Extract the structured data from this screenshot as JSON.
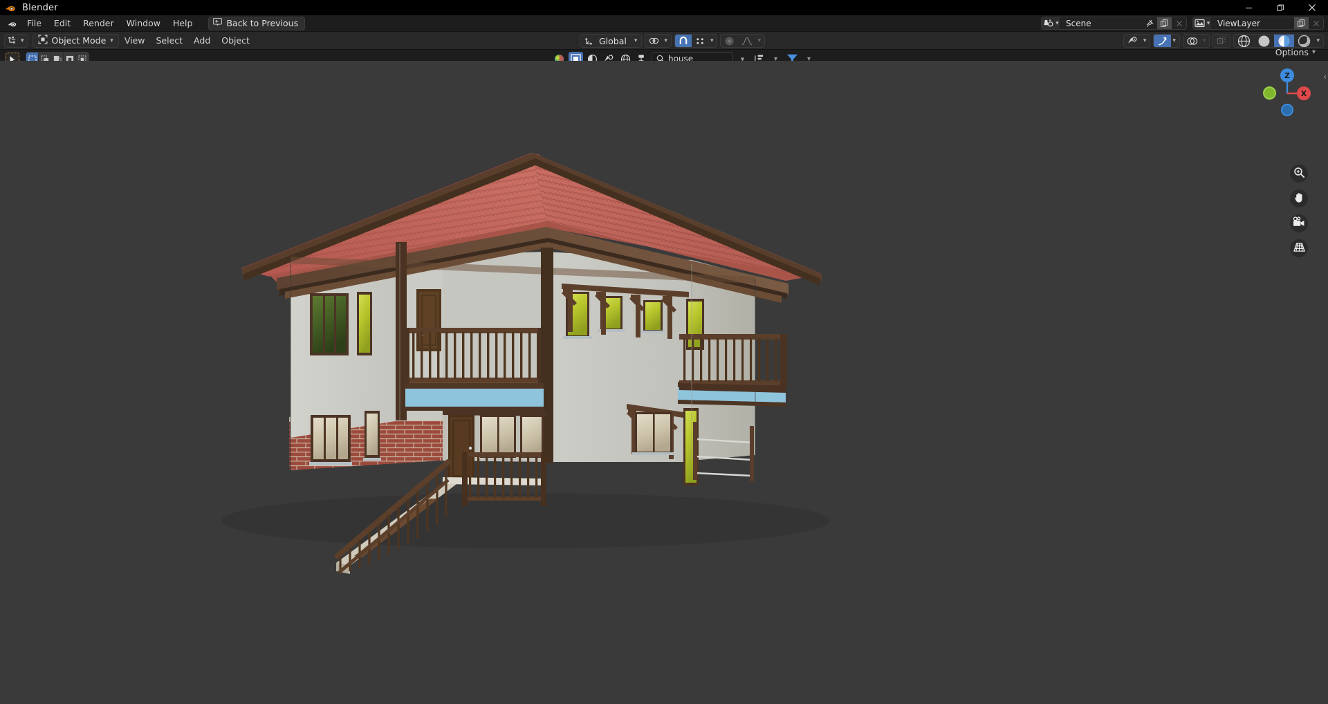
{
  "window": {
    "title": "Blender",
    "controls": {
      "minimize": "—",
      "restore": "❐",
      "close": "✕"
    }
  },
  "menubar": {
    "logo_icon": "blender-logo-icon",
    "items": [
      {
        "label": "File"
      },
      {
        "label": "Edit"
      },
      {
        "label": "Render"
      },
      {
        "label": "Window"
      },
      {
        "label": "Help"
      }
    ],
    "back_to_previous": {
      "label": "Back to Previous",
      "icon": "back-to-previous-icon"
    },
    "scene": {
      "icon": "scene-data-icon",
      "name": "Scene",
      "pin_icon": "pin-icon",
      "new_icon": "new-scene-icon",
      "unlink_icon": "unlink-icon"
    },
    "viewlayer": {
      "icon": "view-layer-icon",
      "name": "ViewLayer",
      "new_icon": "new-viewlayer-icon",
      "unlink_icon": "unlink-icon"
    }
  },
  "viewport_header": {
    "editor_type_icon": "editor-type-3dview-icon",
    "mode": {
      "icon": "object-mode-icon",
      "label": "Object Mode",
      "chevron": "⌄"
    },
    "menus": [
      {
        "label": "View"
      },
      {
        "label": "Select"
      },
      {
        "label": "Add"
      },
      {
        "label": "Object"
      }
    ],
    "transform_orientation": {
      "icon": "transform-orientation-icon",
      "label": "Global",
      "chevron": "⌄"
    },
    "pivot_point": {
      "icon": "pivot-point-icon",
      "chevron": "⌄"
    },
    "snap": {
      "icon": "snap-magnet-icon",
      "active": true
    },
    "snap_target": {
      "icon": "snap-target-icon",
      "chevron": "⌄"
    },
    "proportional_edit": {
      "icon": "proportional-edit-icon",
      "active": false
    },
    "falloff": {
      "icon": "proportional-falloff-icon",
      "chevron": "⌄"
    },
    "right_tools": {
      "visibility": {
        "icon": "object-visibility-icon",
        "chevron": "⌄"
      },
      "gizmo": {
        "icon": "gizmo-icon",
        "active": true,
        "chevron": "⌄"
      },
      "overlays": {
        "icon": "overlays-icon",
        "active": false,
        "chevron": "⌄"
      },
      "xray": {
        "icon": "toggle-xray-icon",
        "active": false
      }
    },
    "shading_modes": [
      {
        "name": "wireframe-shading",
        "active": false
      },
      {
        "name": "solid-shading",
        "active": false
      },
      {
        "name": "material-preview-shading",
        "active": true
      },
      {
        "name": "rendered-shading",
        "active": false
      }
    ],
    "shading_chevron": "⌄"
  },
  "toolbar": {
    "tweak_tool": {
      "icon": "tweak-cursor-icon",
      "active": true
    },
    "select_modes": [
      {
        "name": "select-set",
        "icon": "select-box-icon",
        "active": true
      },
      {
        "name": "select-extend",
        "icon": "select-extend-icon",
        "active": false
      },
      {
        "name": "select-subtract",
        "icon": "select-subtract-icon",
        "active": false
      },
      {
        "name": "select-invert",
        "icon": "select-invert-icon",
        "active": false
      },
      {
        "name": "select-intersect",
        "icon": "select-intersect-icon",
        "active": false
      }
    ],
    "sidebar_chevron": "›",
    "options": {
      "label": "Options",
      "chevron": "⌄"
    }
  },
  "outliner_search": {
    "display_mode_icon": "outliner-display-mode-icon",
    "filter_icons": [
      {
        "name": "restrict-select-icon",
        "active": true
      },
      {
        "name": "restrict-render-icon",
        "active": false
      },
      {
        "name": "restrict-view-icon",
        "active": false
      },
      {
        "name": "restrict-world-icon",
        "active": false
      },
      {
        "name": "restrict-paint-icon",
        "active": false
      }
    ],
    "search": {
      "icon": "search-icon",
      "value": "house",
      "placeholder": "Search"
    },
    "collapse_chevron": "⌄",
    "sort_icon": "sort-alpha-icon",
    "sort_chevron": "⌄",
    "filter_funnel_icon": "filter-funnel-icon",
    "filter_chevron": "⌄"
  },
  "navigation": {
    "gizmo": {
      "axes": [
        {
          "label": "Z",
          "color": "#3c8ce0",
          "name": "gizmo-axis-z"
        },
        {
          "label": "X",
          "color": "#e0484a",
          "name": "gizmo-axis-x"
        },
        {
          "label": "",
          "color": "#7fb82e",
          "name": "gizmo-axis-y"
        },
        {
          "label": "",
          "color": "#2b6fae",
          "name": "gizmo-axis-neg-z"
        }
      ]
    },
    "buttons": [
      {
        "name": "zoom-view-button",
        "icon": "magnifier-icon"
      },
      {
        "name": "pan-view-button",
        "icon": "hand-icon"
      },
      {
        "name": "camera-view-button",
        "icon": "camera-icon"
      },
      {
        "name": "toggle-orthographic-button",
        "icon": "grid-perspective-icon"
      }
    ],
    "collapse_chevron": "‹"
  },
  "viewport": {
    "background_color": "#3a3a3a",
    "scene_object": "house",
    "model": {
      "name": "two-storey-house",
      "colors": {
        "roof_tile": "#c4695f",
        "roof_tile_dark": "#a9554d",
        "roof_ridge": "#b75f56",
        "wall_light": "#d9d9d4",
        "wall_mid": "#c3c3bc",
        "wall_shadow": "#a9a9a1",
        "wood_trim": "#4a3326",
        "wood_light": "#6b4a33",
        "wood_beam": "#5c3f2c",
        "brick": "#9c4a3c",
        "brick_dark": "#7e3a2f",
        "brick_mortar": "#c9b9a8",
        "awning_blue": "#8fc4dd",
        "glass_green": "#b7c52c",
        "glass_cream": "#cfc4ad",
        "ground_shadow": "#2f2f2f"
      }
    }
  }
}
